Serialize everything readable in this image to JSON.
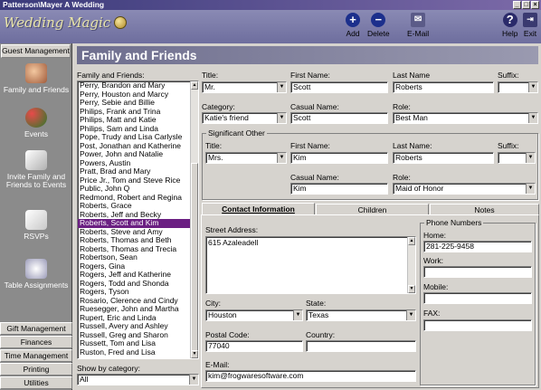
{
  "window": {
    "title": "Patterson\\Mayer A Wedding"
  },
  "app": {
    "logo_text": "Wedding Magic"
  },
  "toolbar": {
    "add": "Add",
    "delete": "Delete",
    "email": "E-Mail",
    "help": "Help",
    "exit": "Exit"
  },
  "sidebar": {
    "header": "Guest Management",
    "items": [
      {
        "label": "Family and Friends",
        "icon": "people-icon"
      },
      {
        "label": "Events",
        "icon": "balloons-icon"
      },
      {
        "label": "Invite Family and Friends to Events",
        "icon": "invitation-icon"
      },
      {
        "label": "RSVPs",
        "icon": "rsvp-icon"
      },
      {
        "label": "Table Assignments",
        "icon": "table-icon"
      }
    ],
    "bottom": [
      "Gift Management",
      "Finances",
      "Time Management",
      "Printing",
      "Utilities"
    ]
  },
  "page": {
    "title": "Family and Friends"
  },
  "list": {
    "label": "Family and Friends:",
    "selected": "Roberts, Scott and Kim",
    "rows": [
      "Perry, Brandon and Mary",
      "Perry, Houston and Marcy",
      "Perry, Sebie and Billie",
      "Philips, Frank and Trina",
      "Philips, Matt and Katie",
      "Philips, Sam and Linda",
      "Pope, Trudy and Lisa Carlysle",
      "Post, Jonathan and Katherine",
      "Power, John and Natalie",
      "Powers, Austin",
      "Pratt, Brad and Mary",
      "Price Jr., Tom and Steve Rice",
      "Public, John Q",
      "Redmond, Robert and Regina",
      "Roberts, Grace",
      "Roberts, Jeff and Becky",
      "Roberts, Scott and Kim",
      "Roberts, Steve and Amy",
      "Roberts, Thomas and Beth",
      "Roberts, Thomas and Trecia",
      "Robertson, Sean",
      "Rogers, Gina",
      "Rogers, Jeff and Katherine",
      "Rogers, Todd and Shonda",
      "Rogers, Tyson",
      "Rosario, Clerence and Cindy",
      "Ruesegger, John and Martha",
      "Rupert, Eric and Linda",
      "Russell, Avery and Ashley",
      "Russell, Greg and Sharon",
      "Russett, Tom and Lisa",
      "Ruston, Fred and Lisa"
    ]
  },
  "filter": {
    "label": "Show by category:",
    "value": "All"
  },
  "guest": {
    "title_label": "Title:",
    "title": "Mr.",
    "first_label": "First Name:",
    "first": "Scott",
    "last_label": "Last Name",
    "last": "Roberts",
    "suffix_label": "Suffix:",
    "suffix": "",
    "category_label": "Category:",
    "category": "Katie's friend",
    "casual_label": "Casual Name:",
    "casual": "Scott",
    "role_label": "Role:",
    "role": "Best Man"
  },
  "significant": {
    "group": "Significant Other",
    "title_label": "Title:",
    "title": "Mrs.",
    "first_label": "First Name:",
    "first": "Kim",
    "last_label": "Last Name:",
    "last": "Roberts",
    "suffix_label": "Suffix:",
    "suffix": "",
    "casual_label": "Casual Name:",
    "casual": "Kim",
    "role_label": "Role:",
    "role": "Maid of Honor"
  },
  "tabs": [
    "Contact Information",
    "Children",
    "Notes"
  ],
  "contact": {
    "street_label": "Street Address:",
    "street": "615 Azaleadell",
    "city_label": "City:",
    "city": "Houston",
    "state_label": "State:",
    "state": "Texas",
    "postal_label": "Postal Code:",
    "postal": "77040",
    "country_label": "Country:",
    "country": "",
    "email_label": "E-Mail:",
    "email": "kim@frogwaresoftware.com",
    "phone_group": "Phone Numbers",
    "home_label": "Home:",
    "home": "281-225-9458",
    "work_label": "Work:",
    "work": "",
    "mobile_label": "Mobile:",
    "mobile": "",
    "fax_label": "FAX:",
    "fax": ""
  }
}
